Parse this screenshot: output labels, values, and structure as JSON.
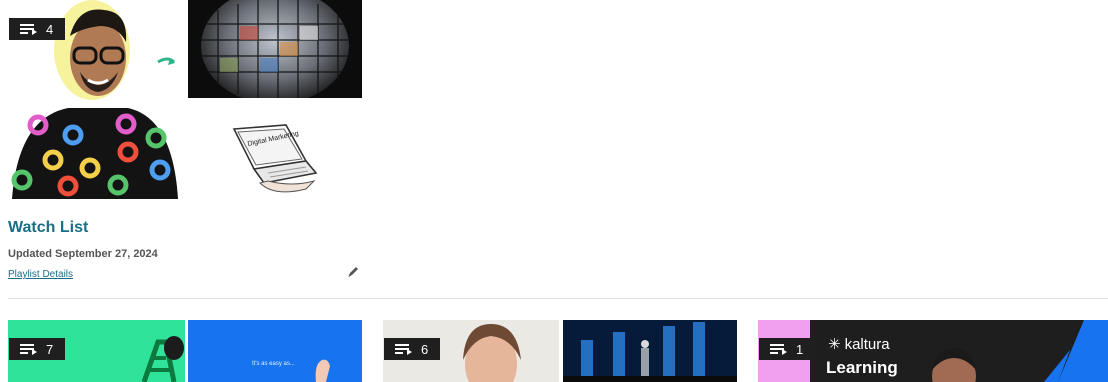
{
  "playlists": [
    {
      "count": "4",
      "title": "Watch List",
      "updated": "Updated September 27, 2024",
      "details_link": "Playlist Details",
      "thumb_text": "Digital Marketing"
    },
    {
      "count": "7",
      "thumb_text": "It's as easy as..."
    },
    {
      "count": "6"
    },
    {
      "count": "1",
      "brand": "kaltura",
      "thumb_text": "Learning"
    }
  ],
  "colors": {
    "link": "#1b6e84",
    "badge_bg": "#1f1f1f",
    "green": "#2fe39a",
    "blue": "#1773f0",
    "pink": "#f1a0f0"
  },
  "icons": {
    "playlist": "playlist-icon",
    "edit": "pencil-icon"
  }
}
